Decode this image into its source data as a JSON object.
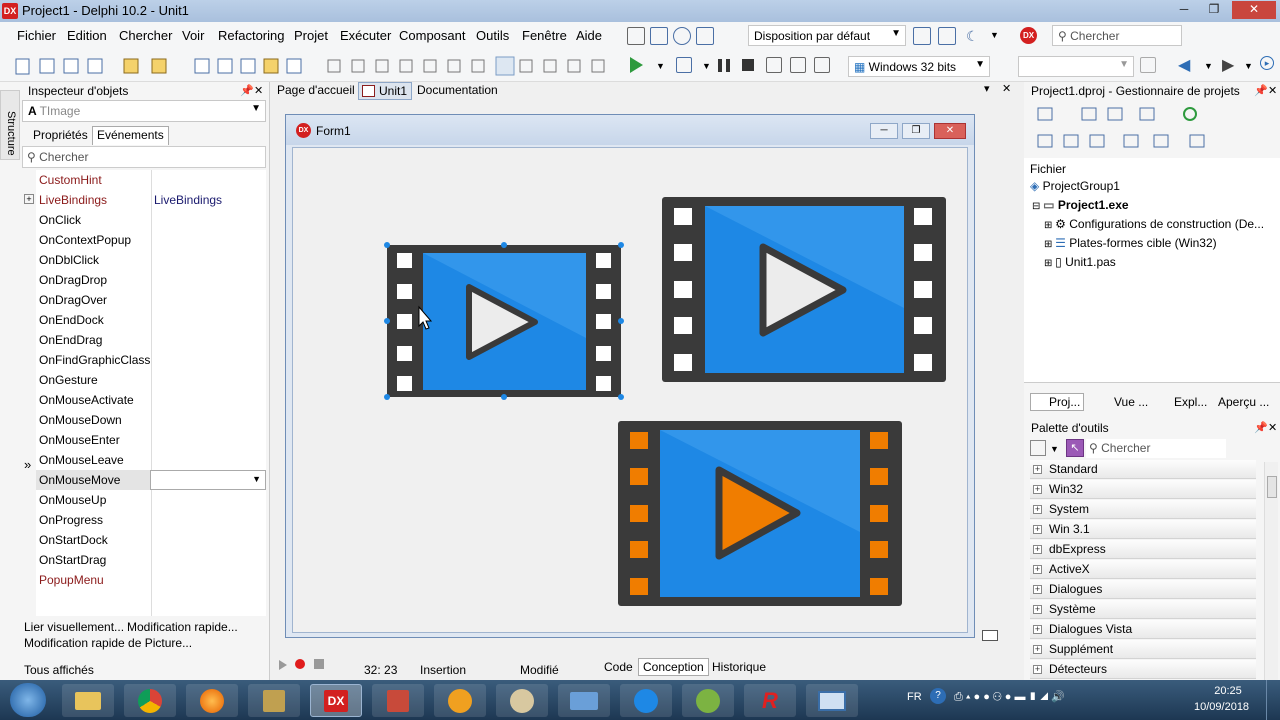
{
  "window": {
    "title": "Project1 - Delphi 10.2 - Unit1",
    "logo_text": "DX"
  },
  "menu": [
    "Fichier",
    "Edition",
    "Chercher",
    "Voir",
    "Refactoring",
    "Projet",
    "Exécuter",
    "Composant",
    "Outils",
    "Fenêtre",
    "Aide"
  ],
  "toolbar": {
    "layout_value": "Disposition par défaut",
    "search_placeholder": "Chercher",
    "platform_value": "Windows 32 bits"
  },
  "object_inspector": {
    "title": "Inspecteur d'objets",
    "selected_component": "TImage",
    "tab_properties": "Propriétés",
    "tab_events": "Evénements",
    "search_placeholder": "Chercher",
    "events": [
      {
        "name": "CustomHint",
        "value": ""
      },
      {
        "name": "LiveBindings",
        "value": "LiveBindings"
      },
      {
        "name": "OnClick",
        "value": ""
      },
      {
        "name": "OnContextPopup",
        "value": ""
      },
      {
        "name": "OnDblClick",
        "value": ""
      },
      {
        "name": "OnDragDrop",
        "value": ""
      },
      {
        "name": "OnDragOver",
        "value": ""
      },
      {
        "name": "OnEndDock",
        "value": ""
      },
      {
        "name": "OnEndDrag",
        "value": ""
      },
      {
        "name": "OnFindGraphicClass",
        "value": ""
      },
      {
        "name": "OnGesture",
        "value": ""
      },
      {
        "name": "OnMouseActivate",
        "value": ""
      },
      {
        "name": "OnMouseDown",
        "value": ""
      },
      {
        "name": "OnMouseEnter",
        "value": ""
      },
      {
        "name": "OnMouseLeave",
        "value": ""
      },
      {
        "name": "OnMouseMove",
        "value": ""
      },
      {
        "name": "OnMouseUp",
        "value": ""
      },
      {
        "name": "OnProgress",
        "value": ""
      },
      {
        "name": "OnStartDock",
        "value": ""
      },
      {
        "name": "OnStartDrag",
        "value": ""
      },
      {
        "name": "PopupMenu",
        "value": ""
      }
    ],
    "link1": "Lier visuellement...",
    "link2": "Modification rapide...",
    "link3": "Modification rapide de Picture...",
    "footer": "Tous affichés",
    "side_tab": "Structure"
  },
  "editor_tabs": [
    "Page d'accueil",
    "Unit1",
    "Documentation"
  ],
  "form": {
    "title": "Form1",
    "logo_text": "DX"
  },
  "status": {
    "position": "32:  23",
    "mode": "Insertion",
    "modified": "Modifié",
    "tabs": [
      "Code",
      "Conception",
      "Historique"
    ]
  },
  "project_manager": {
    "title": "Project1.dproj - Gestionnaire de projets",
    "column": "Fichier",
    "tree": [
      "ProjectGroup1",
      "Project1.exe",
      "Configurations de construction (De...",
      "Plates-formes cible (Win32)",
      "Unit1.pas"
    ],
    "bottom_tabs": [
      "Proj...",
      "Vue ...",
      "Expl...",
      "Aperçu ..."
    ]
  },
  "palette": {
    "title": "Palette d'outils",
    "search_placeholder": "Chercher",
    "categories": [
      "Standard",
      "Win32",
      "System",
      "Win 3.1",
      "dbExpress",
      "ActiveX",
      "Dialogues",
      "Système",
      "Dialogues Vista",
      "Supplément",
      "Détecteurs"
    ]
  },
  "taskbar": {
    "lang": "FR",
    "time": "20:25",
    "date": "10/09/2018"
  },
  "colors": {
    "film_frame": "#3a3a3a",
    "film_blue": "#1e88e5",
    "play_orange": "#f07d00",
    "selection_handle": "#1e88e5"
  }
}
